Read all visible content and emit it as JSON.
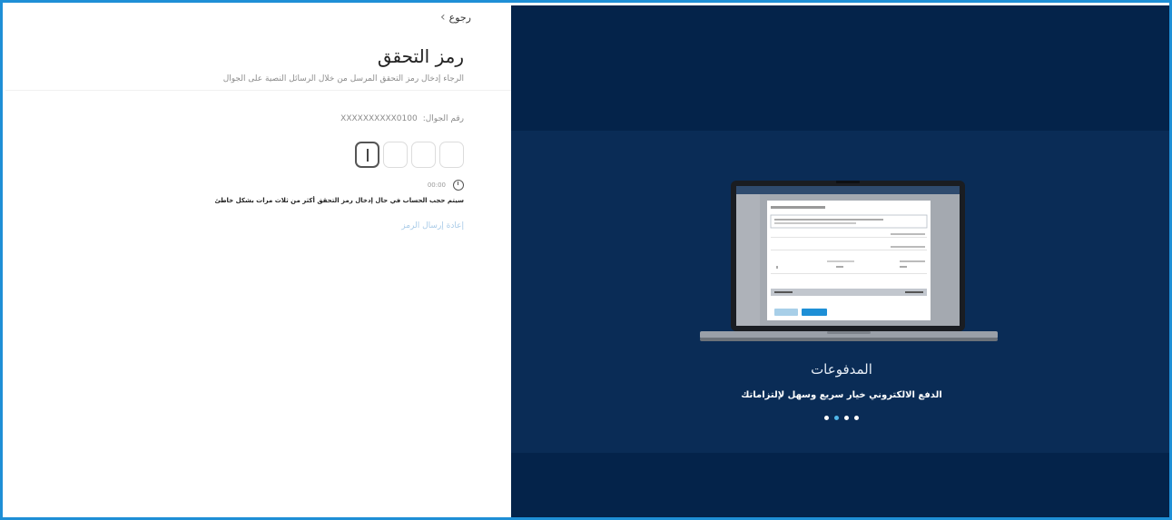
{
  "form": {
    "back_label": "رجوع",
    "title": "رمز التحقق",
    "subtitle": "الرجاء إدخال رمز التحقق المرسل من خلال الرسائل النصية على الجوال",
    "phone_label": "رقم الجوال:",
    "phone_value": "XXXXXXXXXX0100",
    "otp_boxes": [
      "",
      "",
      "",
      ""
    ],
    "timer": "00:00",
    "warning": "سيتم حجب الحساب في حال إدخال رمز التحقق أكثر من ثلاث مرات بشكل خاطئ",
    "resend_label": "إعادة إرسال الرمز"
  },
  "promo": {
    "slide_title": "المدفوعات",
    "slide_description": "الدفع الالكتروني خيار سريع وسهل لإلتزاماتك",
    "dots_count": 4,
    "active_dot": 1
  },
  "colors": {
    "frame_border": "#1e8fd6",
    "promo_bg": "#04234a",
    "promo_band": "#0a2c56",
    "link_color": "#a9cbe8",
    "active_dot": "#4fb6e8"
  }
}
